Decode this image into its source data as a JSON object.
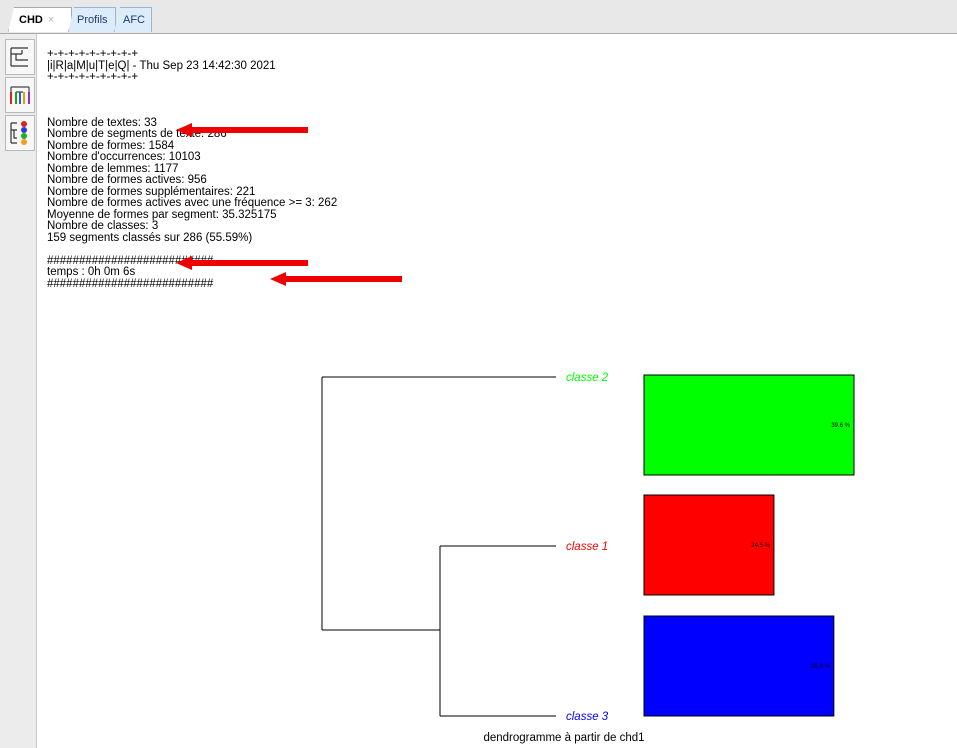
{
  "tabs": [
    {
      "label": "CHD",
      "close": "×",
      "active": true
    },
    {
      "label": "Profils",
      "active": false
    },
    {
      "label": "AFC",
      "active": false
    }
  ],
  "toolbar": {
    "buttons": [
      {
        "icon": "dendrogram-icon"
      },
      {
        "icon": "colored-tree-icon"
      },
      {
        "icon": "classes-dots-icon"
      }
    ]
  },
  "output": {
    "header_lines": [
      "+-+-+-+-+-+-+-+-+",
      "|i|R|a|M|u|T|e|Q| - Thu Sep 23 14:42:30 2021",
      "+-+-+-+-+-+-+-+-+"
    ],
    "stats": [
      "Nombre de textes: 33",
      "Nombre de segments de texte: 286",
      "Nombre de formes: 1584",
      "Nombre d'occurrences: 10103",
      "Nombre de lemmes: 1177",
      "Nombre de formes actives: 956",
      "Nombre de formes supplémentaires: 221",
      "Nombre de formes actives avec une fréquence >= 3: 262",
      "Moyenne de formes par segment: 35.325175",
      "Nombre de classes: 3",
      "159 segments classés sur 286 (55.59%)"
    ],
    "footer_lines": [
      "##########################",
      "temps : 0h 0m 6s",
      "##########################"
    ]
  },
  "chart_data": {
    "type": "dendrogram",
    "title": "dendrogramme à partir de chd1",
    "classes": [
      {
        "label": "classe 2",
        "color": "#00ff00",
        "percent": 39.6,
        "percent_label": "39.6 %"
      },
      {
        "label": "classe 1",
        "color": "#ff0000",
        "percent": 24.5,
        "percent_label": "24.5 %"
      },
      {
        "label": "classe 3",
        "color": "#0000ff",
        "percent": 35.8,
        "percent_label": "35.8 %"
      }
    ],
    "merges": [
      {
        "joins": [
          "classe 1",
          "classe 3"
        ]
      },
      {
        "joins": [
          "classe 2",
          "classe 1 + classe 3"
        ]
      }
    ]
  },
  "colors": {
    "arrow": "#ee0000",
    "tab_active_bg": "#ffffff",
    "tab_inactive_bg": "#dcecfa"
  }
}
